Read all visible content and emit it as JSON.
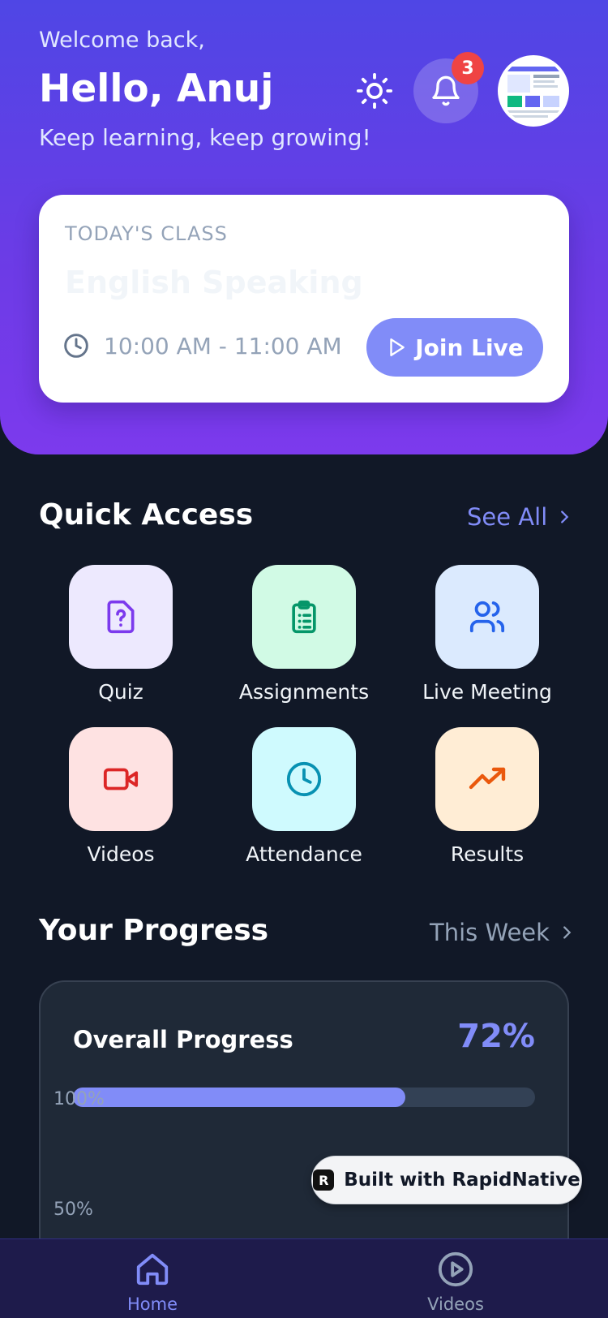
{
  "header": {
    "welcome": "Welcome back,",
    "greeting": "Hello, Anuj",
    "tagline": "Keep learning, keep growing!",
    "notification_count": "3"
  },
  "today_class": {
    "label": "TODAY'S CLASS",
    "title": "English Speaking",
    "time": "10:00 AM - 11:00 AM",
    "join_label": "Join Live"
  },
  "quick_access": {
    "title": "Quick Access",
    "see_all": "See All",
    "items": [
      {
        "label": "Quiz",
        "icon": "quiz-icon",
        "bg": "#EDE9FE",
        "fg": "#7C3AED"
      },
      {
        "label": "Assignments",
        "icon": "clipboard-icon",
        "bg": "#D1FAE5",
        "fg": "#059669"
      },
      {
        "label": "Live Meeting",
        "icon": "users-icon",
        "bg": "#DBEAFE",
        "fg": "#2563EB"
      },
      {
        "label": "Videos",
        "icon": "video-icon",
        "bg": "#FEE2E2",
        "fg": "#DC2626"
      },
      {
        "label": "Attendance",
        "icon": "clock-icon",
        "bg": "#CFFAFE",
        "fg": "#0891B2"
      },
      {
        "label": "Results",
        "icon": "trending-up-icon",
        "bg": "#FFEDD5",
        "fg": "#EA580C"
      }
    ]
  },
  "progress": {
    "title": "Your Progress",
    "period": "This Week",
    "card_title": "Overall Progress",
    "percent_label": "72%",
    "percent_value": 0.72,
    "axis_labels": [
      "100%",
      "50%"
    ]
  },
  "built_with": "Built with RapidNative",
  "bottom_nav": [
    {
      "label": "Home",
      "icon": "home-icon",
      "active": true
    },
    {
      "label": "Videos",
      "icon": "play-circle-icon",
      "active": false
    }
  ],
  "colors": {
    "accent": "#818CF8",
    "header_start": "#4F46E5",
    "header_end": "#7C3AED",
    "background": "#111827",
    "badge": "#EF4444"
  }
}
